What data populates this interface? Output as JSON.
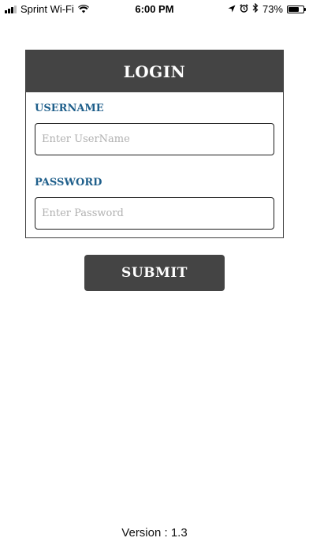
{
  "status_bar": {
    "carrier": "Sprint Wi-Fi",
    "time": "6:00 PM",
    "battery_percent": "73%",
    "battery_level": 0.73,
    "icons": [
      "signal-bars-icon",
      "wifi-icon",
      "location-arrow-icon",
      "alarm-clock-icon",
      "bluetooth-icon",
      "battery-icon"
    ]
  },
  "login": {
    "title": "LOGIN",
    "username_label": "USERNAME",
    "username_placeholder": "Enter UserName",
    "username_value": "",
    "password_label": "PASSWORD",
    "password_placeholder": "Enter Password",
    "password_value": "",
    "submit_label": "SUBMIT"
  },
  "footer": {
    "version": "Version : 1.3"
  },
  "colors": {
    "header_bg": "#444444",
    "label_blue": "#1f5f8b",
    "button_bg": "#444444"
  }
}
